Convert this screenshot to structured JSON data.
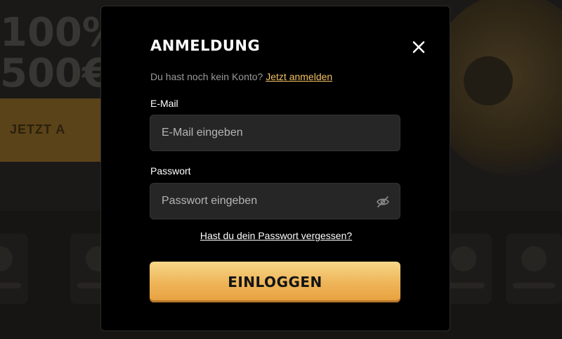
{
  "background": {
    "promo_line1": "100%",
    "promo_line2": "500€",
    "cta_label": "JETZT A"
  },
  "modal": {
    "title": "ANMELDUNG",
    "close_icon": "close-icon",
    "signup_prompt": "Du hast noch kein Konto?",
    "signup_link": "Jetzt anmelden",
    "email": {
      "label": "E-Mail",
      "value": "",
      "placeholder": "E-Mail eingeben"
    },
    "password": {
      "label": "Passwort",
      "value": "",
      "placeholder": "Passwort eingeben",
      "toggle_icon": "eye-off-icon"
    },
    "forgot_link": "Hast du dein Passwort vergessen?",
    "login_button": "EINLOGGEN"
  },
  "colors": {
    "accent_link": "#f2c160",
    "button_gold": "#efb65a",
    "modal_bg": "#000000",
    "input_bg": "#262626"
  }
}
